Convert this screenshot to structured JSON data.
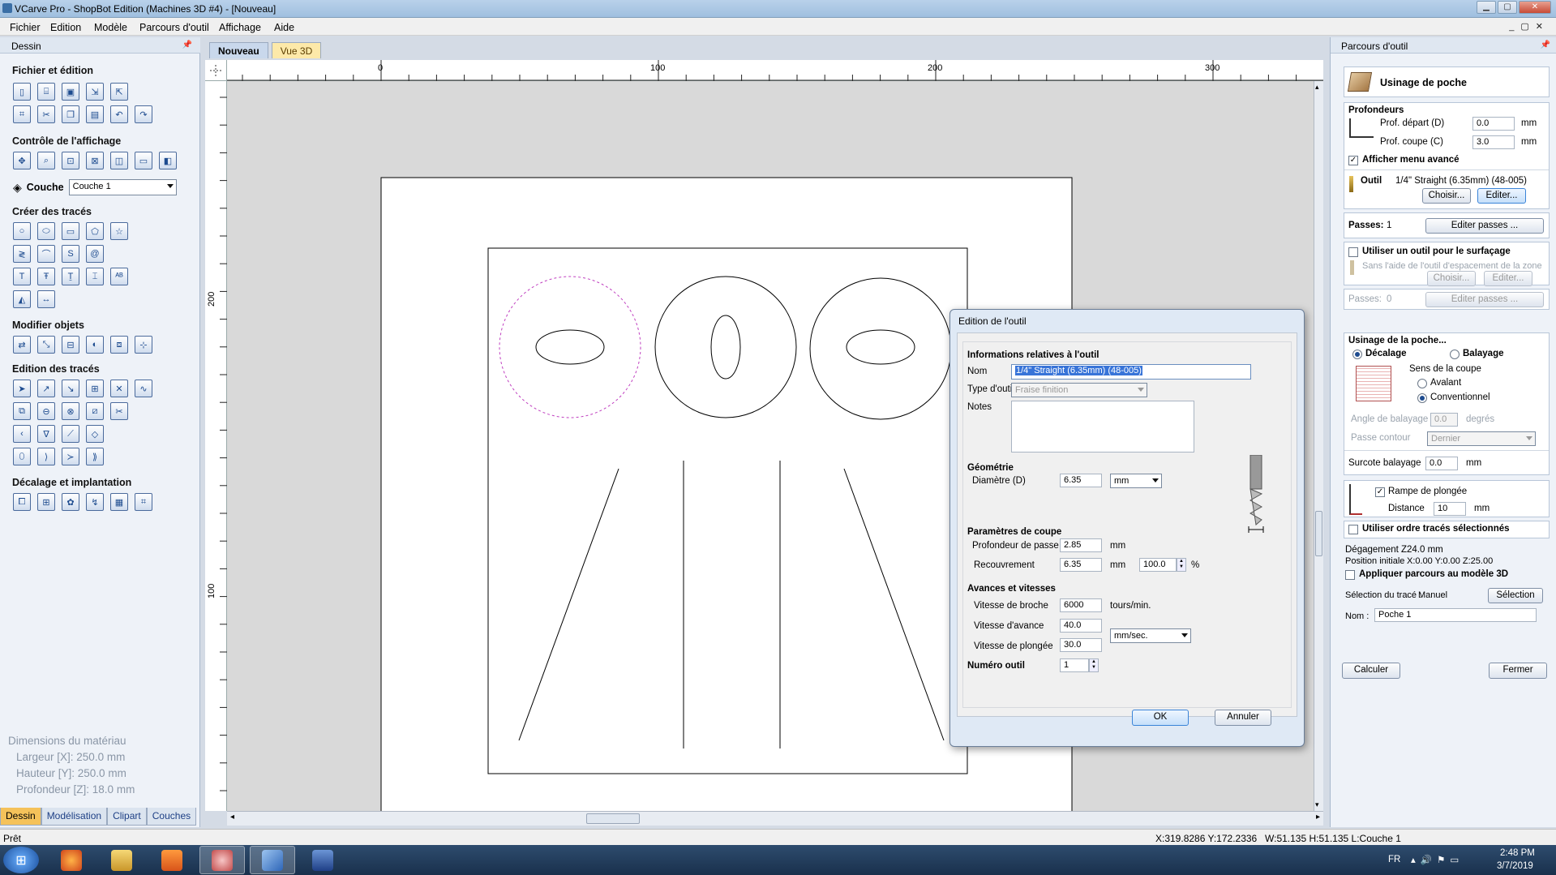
{
  "window": {
    "title": "VCarve Pro - ShopBot Edition (Machines 3D #4) - [Nouveau]"
  },
  "menu": [
    "Fichier",
    "Edition",
    "Modèle",
    "Parcours d'outil",
    "Affichage",
    "Aide"
  ],
  "left_panel": {
    "header": "Dessin",
    "sections": {
      "file_edit": "Fichier et édition",
      "view_control": "Contrôle de l'affichage",
      "create_vectors": "Créer des tracés",
      "modify_objects": "Modifier objets",
      "edit_vectors": "Edition des tracés",
      "offset_layout": "Décalage et implantation"
    },
    "layer_label": "Couche",
    "layer_value": "Couche 1",
    "material": {
      "title": "Dimensions du matériau",
      "width": "Largeur   [X]: 250.0 mm",
      "height": "Hauteur   [Y]: 250.0 mm",
      "depth": "Profondeur [Z]: 18.0 mm"
    },
    "bottom_tabs": [
      "Dessin",
      "Modélisation",
      "Clipart",
      "Couches"
    ]
  },
  "doc_tabs": [
    "Nouveau",
    "Vue 3D"
  ],
  "rulers": {
    "h_labels": [
      "0",
      "100",
      "200",
      "300"
    ],
    "v_labels": [
      "200",
      "100"
    ]
  },
  "right_panel": {
    "header": "Parcours d'outil",
    "title": "Usinage de poche",
    "depths": {
      "heading": "Profondeurs",
      "start_label": "Prof. départ (D)",
      "start_value": "0.0",
      "cut_label": "Prof. coupe (C)",
      "cut_value": "3.0",
      "unit": "mm",
      "advanced": "Afficher menu avancé"
    },
    "tool": {
      "label": "Outil",
      "name": "1/4\" Straight (6.35mm)  (48-005)",
      "choose": "Choisir...",
      "edit": "Editer...",
      "passes_label": "Passes:",
      "passes_value": "1",
      "edit_passes": "Editer passes ..."
    },
    "area_clear": {
      "title": "Utiliser un outil pour le surfaçage",
      "desc": "Sans l'aide de l'outil d'espacement de la zone",
      "choose": "Choisir...",
      "edit": "Editer...",
      "passes_label": "Passes:",
      "passes_value": "0",
      "edit_passes": "Editer passes ..."
    },
    "pocket": {
      "title": "Usinage de la poche...",
      "offset": "Décalage",
      "raster": "Balayage",
      "direction_title": "Sens de la coupe",
      "climb": "Avalant",
      "conventional": "Conventionnel",
      "raster_angle_label": "Angle de balayage",
      "raster_angle_value": "0.0",
      "raster_angle_unit": "degrés",
      "profile_pass_label": "Passe contour",
      "profile_pass_value": "Dernier",
      "raster_allow_label": "Surcote balayage",
      "raster_allow_value": "0.0",
      "raster_allow_unit": "mm"
    },
    "ramp": {
      "label": "Rampe de plongée",
      "distance_label": "Distance",
      "distance_value": "10",
      "unit": "mm"
    },
    "order": "Utiliser ordre tracés sélectionnés",
    "clearance": {
      "zlabel": "Dégagement Z",
      "zvalue": "24.0 mm",
      "home_label": "Position initiale",
      "home_value": "X:0.00 Y:0.00 Z:25.00"
    },
    "apply3d": "Appliquer parcours au modèle 3D",
    "selection": {
      "label": "Sélection du tracé :",
      "mode": "Manuel",
      "button": "Sélection"
    },
    "name": {
      "label": "Nom :",
      "value": "Poche 1"
    },
    "calculate": "Calculer",
    "close": "Fermer"
  },
  "dialog": {
    "title": "Edition de l'outil",
    "info_heading": "Informations relatives à l'outil",
    "name_label": "Nom",
    "name_value": "1/4\" Straight (6.35mm)  (48-005)",
    "type_label": "Type d'outil",
    "type_value": "Fraise finition",
    "notes_label": "Notes",
    "geometry_heading": "Géométrie",
    "diameter_label": "Diamètre (D)",
    "diameter_value": "6.35",
    "diameter_unit": "mm",
    "cutting_heading": "Paramètres de coupe",
    "pass_depth_label": "Profondeur de passe",
    "pass_depth_value": "2.85",
    "pass_depth_unit": "mm",
    "stepover_label": "Recouvrement",
    "stepover_value": "6.35",
    "stepover_unit": "mm",
    "stepover_pct": "100.0",
    "pct": "%",
    "feeds_heading": "Avances et vitesses",
    "spindle_label": "Vitesse de broche",
    "spindle_value": "6000",
    "spindle_unit": "tours/min.",
    "feed_label": "Vitesse d'avance",
    "feed_value": "40.0",
    "plunge_label": "Vitesse de plongée",
    "plunge_value": "30.0",
    "rate_unit": "mm/sec.",
    "tool_number_label": "Numéro outil",
    "tool_number_value": "1",
    "ok": "OK",
    "cancel": "Annuler"
  },
  "status": {
    "left": "Prêt",
    "cursor": "X:319.8286 Y:172.2336",
    "size": "W:51.135  H:51.135  L:Couche 1"
  },
  "taskbar": {
    "lang": "FR",
    "time": "2:48 PM",
    "date": "3/7/2019"
  }
}
